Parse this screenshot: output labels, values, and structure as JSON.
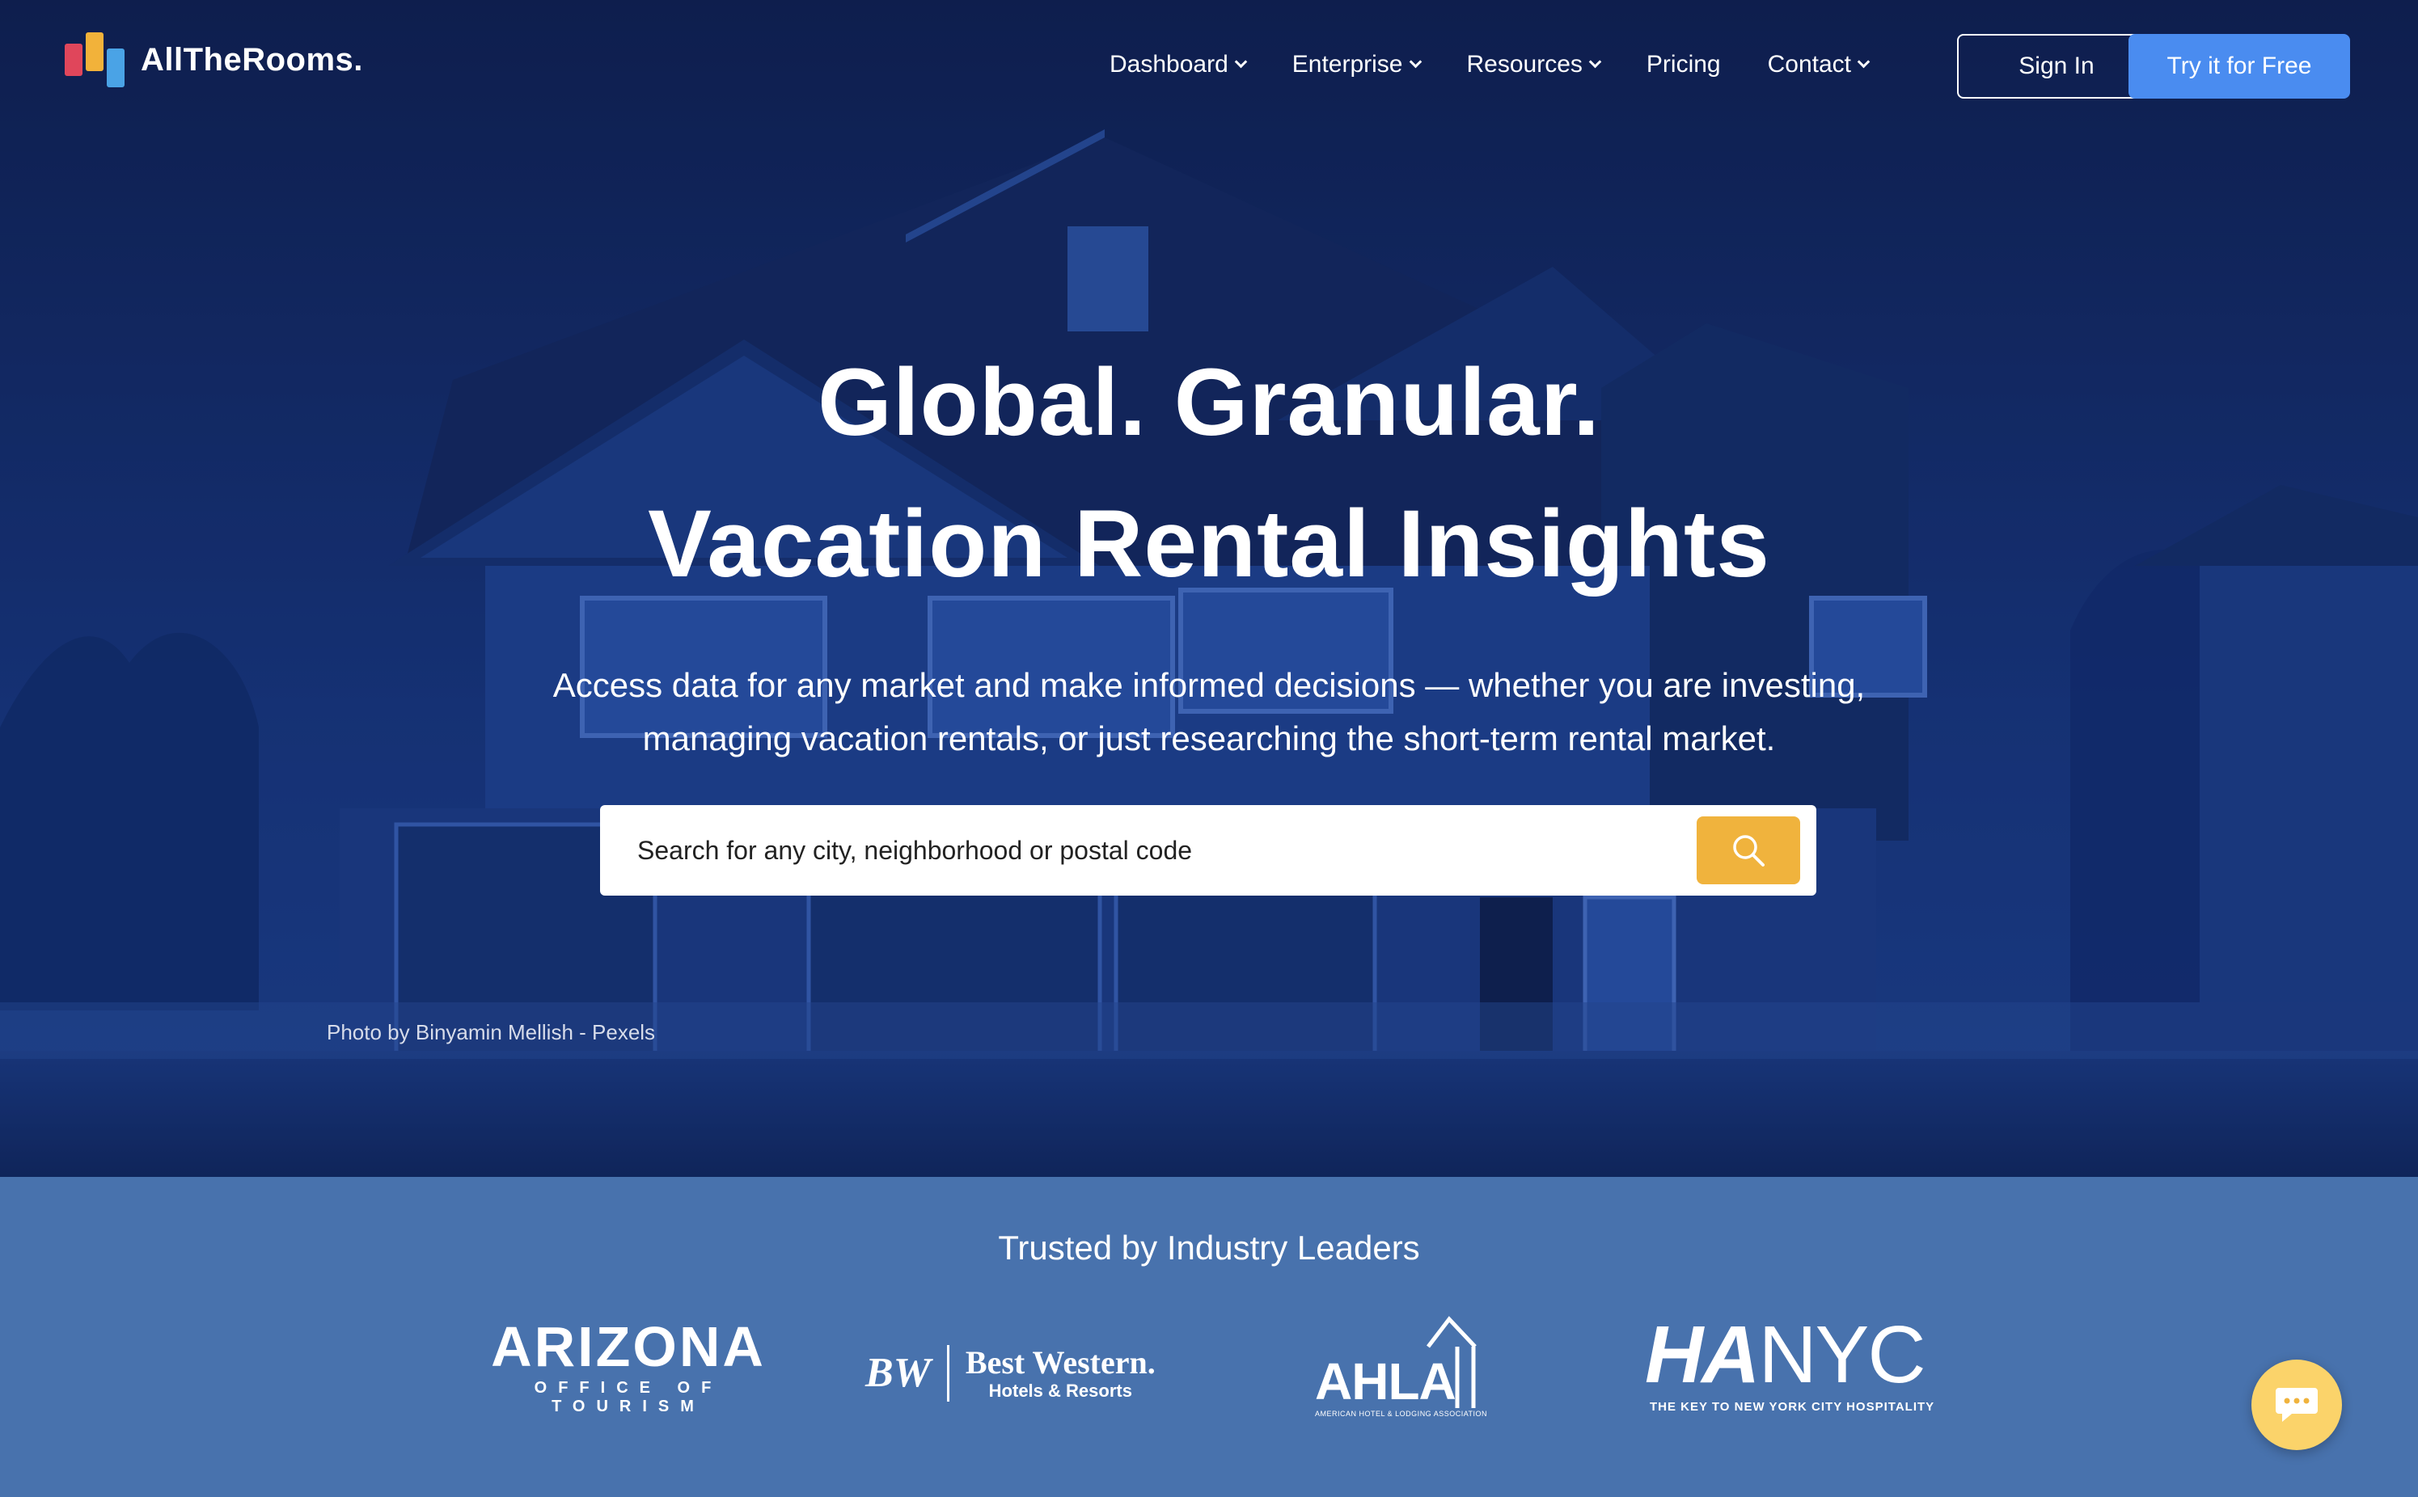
{
  "brand": {
    "name": "AllTheRooms."
  },
  "nav": {
    "items": [
      {
        "label": "Dashboard",
        "dropdown": true
      },
      {
        "label": "Enterprise",
        "dropdown": true
      },
      {
        "label": "Resources",
        "dropdown": true
      },
      {
        "label": "Pricing",
        "dropdown": false
      },
      {
        "label": "Contact",
        "dropdown": true
      }
    ],
    "signin_label": "Sign In",
    "try_label": "Try it for Free"
  },
  "hero": {
    "headline_line1": "Global. Granular.",
    "headline_line2": "Vacation Rental Insights",
    "subtitle_line1": "Access data for any market and make informed decisions — whether you are investing,",
    "subtitle_line2": "managing vacation rentals, or just researching the short-term rental market.",
    "search_placeholder": "Search for any city, neighborhood or postal code",
    "photo_credit": "Photo by Binyamin Mellish - Pexels"
  },
  "trust": {
    "title": "Trusted by Industry Leaders",
    "logos": {
      "arizona": {
        "big": "ARIZONA",
        "small": "OFFICE OF TOURISM"
      },
      "bestwestern": {
        "mark": "BW",
        "name": "Best Western.",
        "sub": "Hotels & Resorts"
      },
      "ahla": {
        "word": "AHLA",
        "tag": "AMERICAN HOTEL & LODGING ASSOCIATION"
      },
      "hanyc": {
        "word_bold": "HA",
        "word_light": "NYC",
        "tag": "THE KEY TO NEW YORK CITY HOSPITALITY"
      }
    }
  },
  "colors": {
    "accent_blue": "#4a8cf0",
    "search_button": "#f0b33d",
    "chat_button": "#fbd36a",
    "trust_bg": "#4872ad"
  },
  "icons": {
    "search": "search-icon",
    "chat": "chat-icon",
    "dropdown": "chevron-down-icon"
  }
}
